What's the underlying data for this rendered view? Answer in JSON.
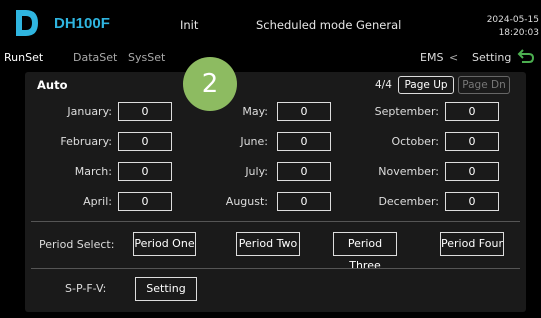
{
  "header": {
    "brand": "DH100F",
    "status_init": "Init",
    "status_mode": "Scheduled mode",
    "status_general": "General",
    "date": "2024-05-15",
    "time": "18:20:03"
  },
  "nav": {
    "tabs": [
      "RunSet",
      "DataSet",
      "SysSet"
    ],
    "breadcrumb": [
      "EMS",
      "<",
      "Setting"
    ]
  },
  "panel": {
    "title": "Auto",
    "page_count": "4/4",
    "page_up": "Page Up",
    "page_down": "Page Dn",
    "months": [
      {
        "label": "January:",
        "value": "0"
      },
      {
        "label": "February:",
        "value": "0"
      },
      {
        "label": "March:",
        "value": "0"
      },
      {
        "label": "April:",
        "value": "0"
      },
      {
        "label": "May:",
        "value": "0"
      },
      {
        "label": "June:",
        "value": "0"
      },
      {
        "label": "July:",
        "value": "0"
      },
      {
        "label": "August:",
        "value": "0"
      },
      {
        "label": "September:",
        "value": "0"
      },
      {
        "label": "October:",
        "value": "0"
      },
      {
        "label": "November:",
        "value": "0"
      },
      {
        "label": "December:",
        "value": "0"
      }
    ],
    "period_label": "Period Select:",
    "periods": [
      "Period One",
      "Period Two",
      "Period Three",
      "Period Four"
    ],
    "spfv_label": "S-P-F-V:",
    "spfv_button": "Setting"
  },
  "overlay_badge": "2",
  "colors": {
    "brand": "#2fb5e0",
    "back_arrow": "#4caf50",
    "badge": "#8dbb61"
  }
}
